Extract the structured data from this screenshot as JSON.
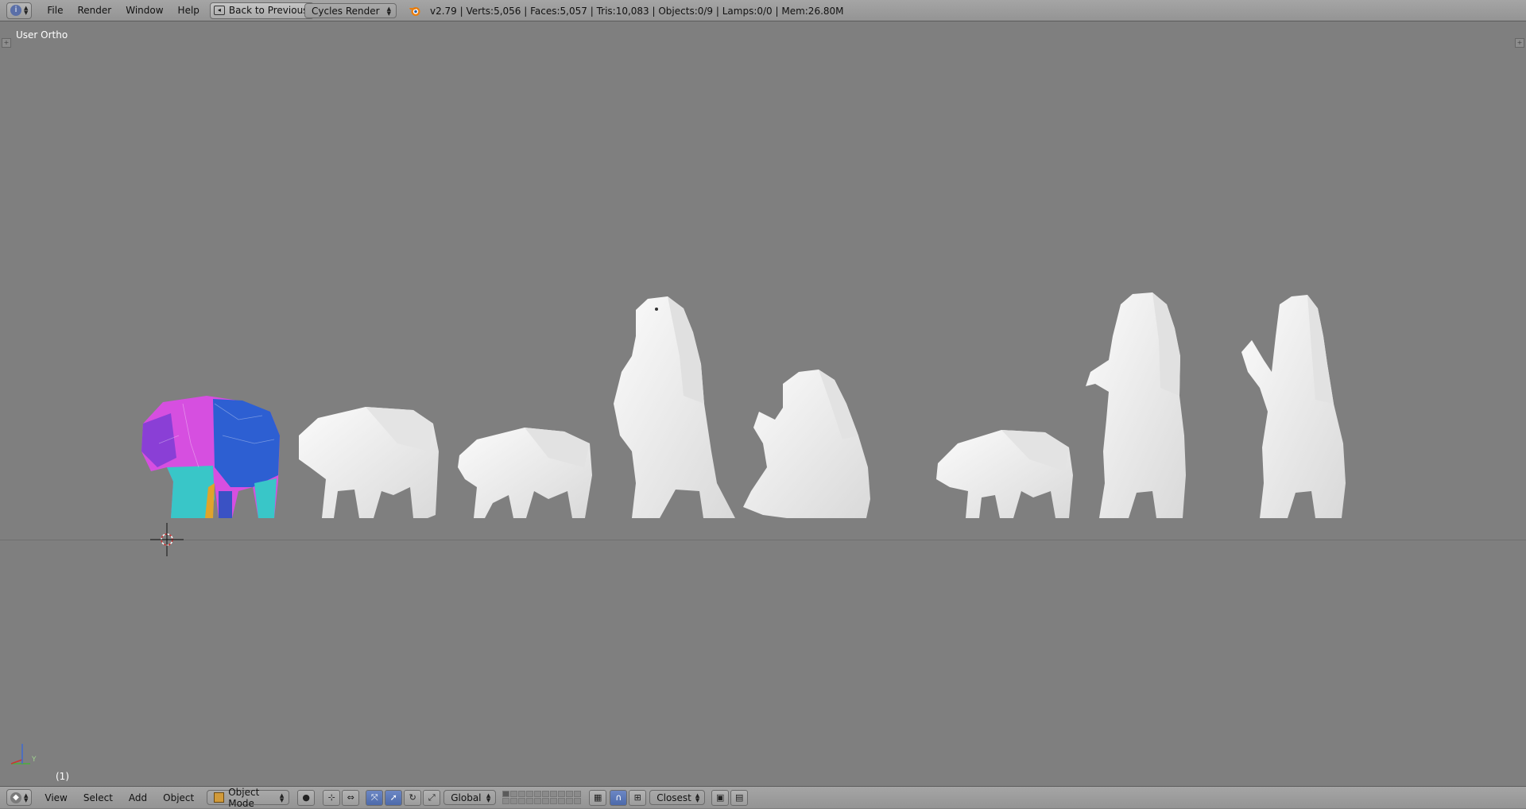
{
  "top_header": {
    "menu": [
      "File",
      "Render",
      "Window",
      "Help"
    ],
    "back_button": "Back to Previous",
    "render_engine": "Cycles Render",
    "stats": "v2.79 | Verts:5,056 | Faces:5,057 | Tris:10,083 | Objects:0/9 | Lamps:0/0 | Mem:26.80M"
  },
  "viewport": {
    "view_label": "User Ortho",
    "frame_label": "(1)"
  },
  "bottom_header": {
    "menu": [
      "View",
      "Select",
      "Add",
      "Object"
    ],
    "mode": "Object Mode",
    "transform_orientation": "Global",
    "snap_target": "Closest"
  },
  "colors": {
    "viewport_bg": "#7f7f7f",
    "model_white": "#f1f1f1",
    "uv_magenta": "#d64fe0",
    "uv_blue": "#2d5fd2",
    "uv_cyan": "#39c6c8",
    "uv_purple": "#8a3fd6"
  }
}
